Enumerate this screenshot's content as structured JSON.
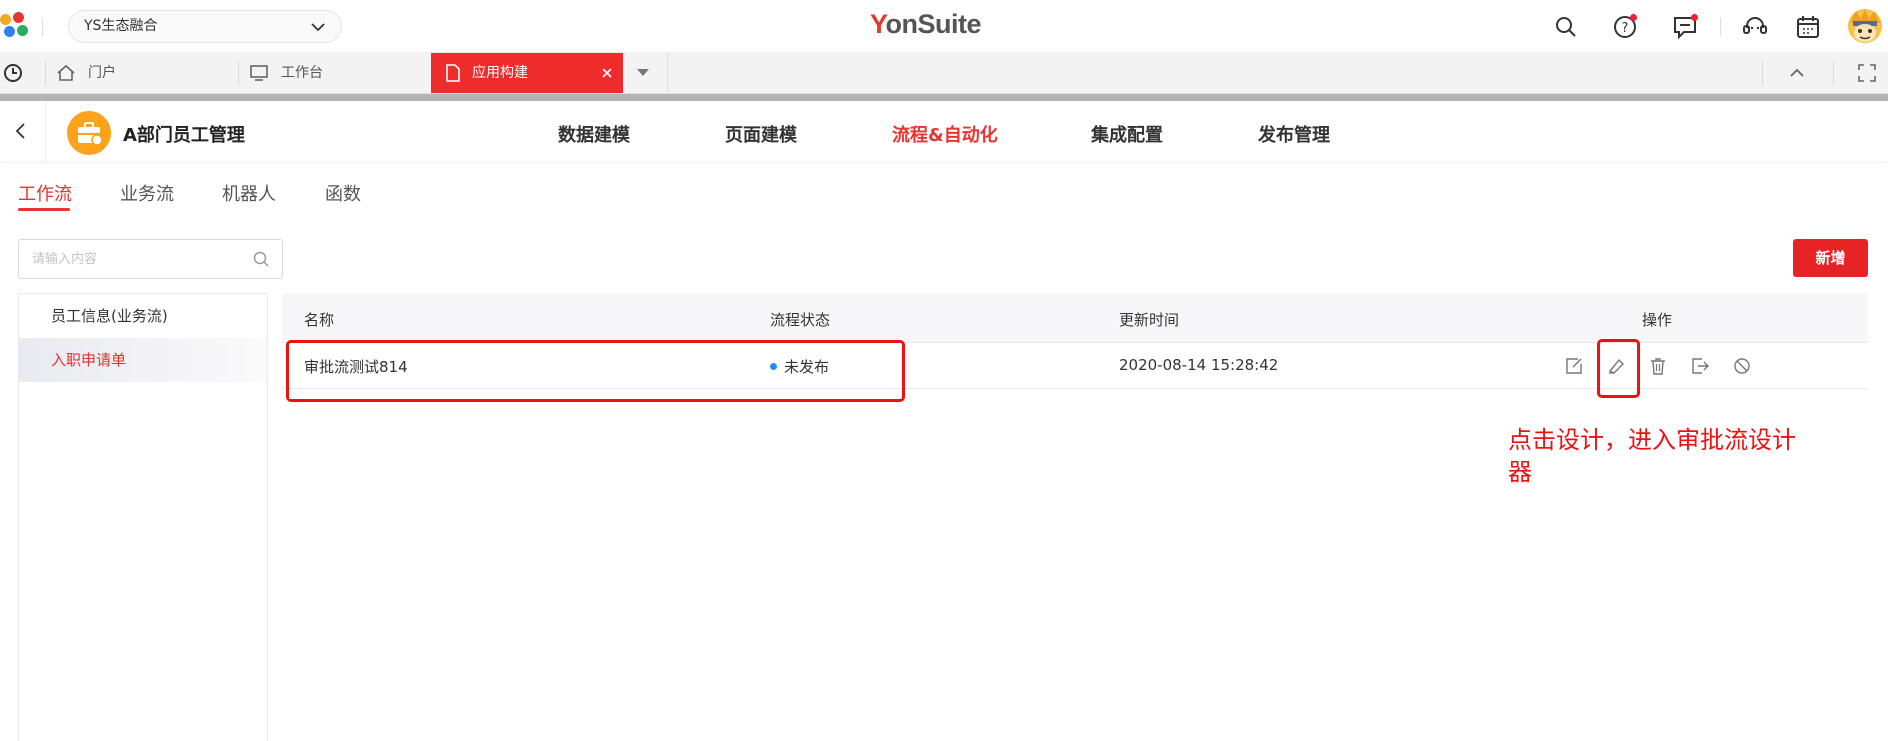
{
  "topbar": {
    "org_select": "YS生态融合",
    "brand_prefix": "Y",
    "brand_rest": "onSuite",
    "icons": [
      "search-icon",
      "help-icon",
      "message-icon",
      "customer-service-icon",
      "calendar-icon",
      "avatar"
    ]
  },
  "tabs": [
    {
      "label": "门户",
      "icon": "home-icon"
    },
    {
      "label": "工作台",
      "icon": "monitor-icon"
    },
    {
      "label": "应用构建",
      "icon": "document-icon",
      "active": true
    }
  ],
  "app": {
    "title": "A部门员工管理",
    "nav": [
      "数据建模",
      "页面建模",
      "流程&自动化",
      "集成配置",
      "发布管理"
    ],
    "active_nav": "流程&自动化"
  },
  "subtabs": [
    "工作流",
    "业务流",
    "机器人",
    "函数"
  ],
  "search": {
    "placeholder": "请输入内容"
  },
  "add_button": "新增",
  "left_list": [
    "员工信息(业务流)",
    "入职申请单"
  ],
  "table": {
    "headers": [
      "名称",
      "流程状态",
      "更新时间",
      "操作"
    ],
    "rows": [
      {
        "name": "审批流测试814",
        "status": "未发布",
        "updated": "2020-08-14 15:28:42"
      }
    ],
    "actions": [
      "edit-icon",
      "design-icon",
      "delete-icon",
      "export-icon",
      "disable-icon"
    ]
  },
  "annotation": "点击设计，进入审批流设计器",
  "colors": {
    "accent": "#e8332f",
    "status_unpublished": "#1b8ff0",
    "annotation": "#ee1111"
  }
}
